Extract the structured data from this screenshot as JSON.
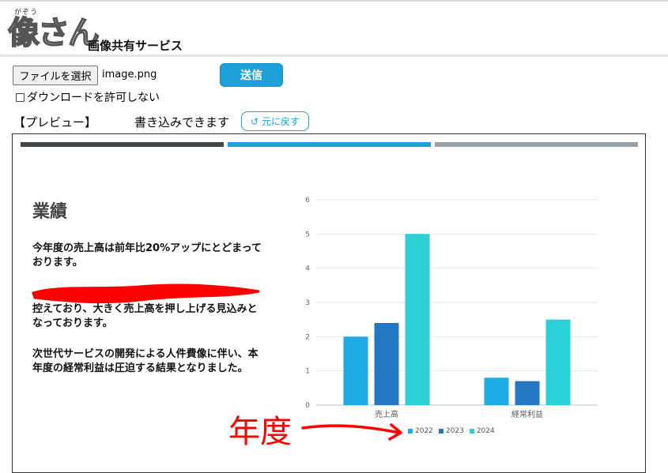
{
  "header": {
    "logo_ruby": "がぞう",
    "logo_text": "像さん",
    "site_title": "画像共有サービス"
  },
  "form": {
    "file_button_label": "ファイルを選択",
    "file_name": "image.png",
    "submit_label": "送信",
    "no_download_label": "ダウンロードを許可しない",
    "no_download_checked": false
  },
  "preview": {
    "label": "【プレビュー】",
    "editable_label": "書き込みできます",
    "reset_label": "元に戻す",
    "reset_icon": "undo-icon"
  },
  "slide": {
    "title": "業績",
    "paragraph1": "今年度の売上高は前年比20%アップにとどまっております。",
    "paragraph2": "控えており、大きく売上高を押し上げる見込みとなっております。",
    "paragraph3": "次世代サービスの開発による人件費像に伴い、本年度の経常利益は圧迫する結果となりました。",
    "redaction_color": "#ff0000",
    "top_bar_colors": [
      "#3f4548",
      "#1ea1d8",
      "#9aa2a8"
    ]
  },
  "annotation": {
    "text": "年度",
    "color": "#ff0000"
  },
  "chart_data": {
    "type": "bar",
    "categories": [
      "売上高",
      "経常利益"
    ],
    "series": [
      {
        "name": "2022",
        "values": [
          2.0,
          0.8
        ],
        "color": "#1eabe3"
      },
      {
        "name": "2023",
        "values": [
          2.4,
          0.7
        ],
        "color": "#2478c2"
      },
      {
        "name": "2024",
        "values": [
          5.0,
          2.5
        ],
        "color": "#2bcfd6"
      }
    ],
    "ylim": [
      0,
      6
    ],
    "yticks": [
      0,
      1,
      2,
      3,
      4,
      5,
      6
    ],
    "grid": true,
    "legend": "bottom"
  }
}
